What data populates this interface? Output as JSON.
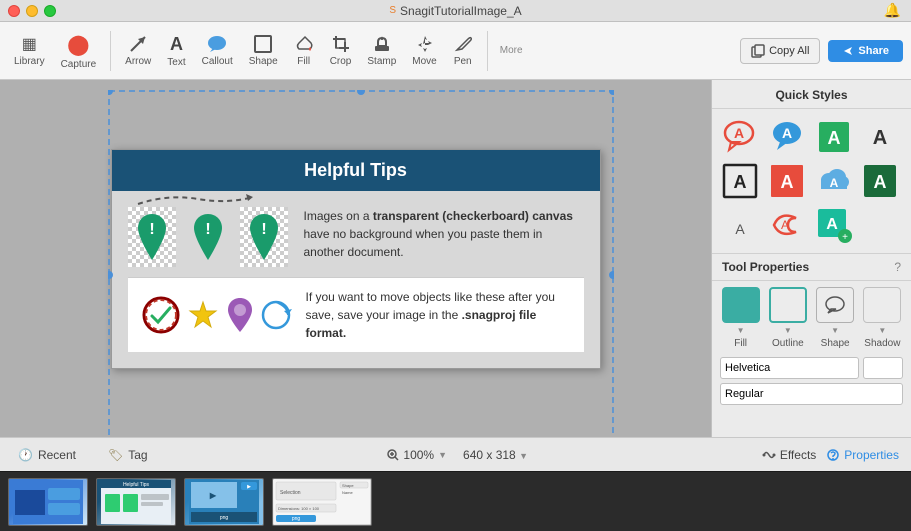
{
  "window": {
    "title": "SnagitTutorialImage_A",
    "traffic_lights": [
      "close",
      "minimize",
      "maximize"
    ]
  },
  "toolbar": {
    "tools": [
      {
        "name": "library",
        "label": "Library",
        "icon": "▦"
      },
      {
        "name": "capture",
        "label": "Capture",
        "icon": "⬤"
      },
      {
        "name": "arrow",
        "label": "Arrow",
        "icon": "↗"
      },
      {
        "name": "text",
        "label": "Text",
        "icon": "A"
      },
      {
        "name": "callout",
        "label": "Callout",
        "icon": "💬"
      },
      {
        "name": "shape",
        "label": "Shape",
        "icon": "□"
      },
      {
        "name": "fill",
        "label": "Fill",
        "icon": "🪣"
      },
      {
        "name": "crop",
        "label": "Crop",
        "icon": "⌗"
      },
      {
        "name": "stamp",
        "label": "Stamp",
        "icon": "★"
      },
      {
        "name": "move",
        "label": "Move",
        "icon": "✥"
      },
      {
        "name": "pen",
        "label": "Pen",
        "icon": "✏"
      },
      {
        "name": "more",
        "label": "More",
        "icon": "…"
      }
    ],
    "copy_all_label": "Copy All",
    "share_label": "Share"
  },
  "canvas": {
    "title": "Helpful Tips",
    "row1_text_html": "Images on a <strong>transparent (checkerboard) canvas</strong> have no background when you paste them in another document.",
    "row2_text_html": "If you want to move objects like these after you save, save your image in the <strong>.snagproj file format.</strong>"
  },
  "right_panel": {
    "quick_styles_title": "Quick Styles",
    "tool_properties_title": "Tool Properties",
    "help_icon": "?",
    "fill_label": "Fill",
    "outline_label": "Outline",
    "shape_label": "Shape",
    "shadow_label": "Shadow",
    "font_name": "Helvetica",
    "font_weight": "Regular",
    "font_size": ""
  },
  "status_bar": {
    "recent_label": "Recent",
    "tag_label": "Tag",
    "zoom_label": "100%",
    "size_label": "640 x 318",
    "effects_label": "Effects",
    "properties_label": "Properties"
  }
}
